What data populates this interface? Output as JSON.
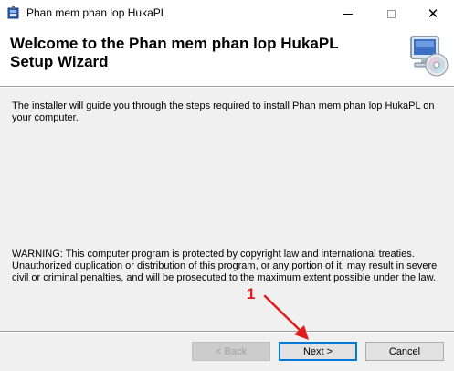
{
  "window": {
    "title": "Phan mem phan lop HukaPL"
  },
  "header": {
    "title": "Welcome to the Phan mem phan lop HukaPL Setup Wizard"
  },
  "body": {
    "intro": "The installer will guide you through the steps required to install Phan mem phan lop HukaPL on your computer.",
    "warning": "WARNING: This computer program is protected by copyright law and international treaties. Unauthorized duplication or distribution of this program, or any portion of it, may result in severe civil or criminal penalties, and will be prosecuted to the maximum extent possible under the law."
  },
  "buttons": {
    "back": "< Back",
    "next": "Next >",
    "cancel": "Cancel"
  },
  "annotation": {
    "step_number": "1",
    "color": "#e21b1b"
  },
  "icons": {
    "app": "installer-package-icon",
    "setup": "computer-cd-icon"
  }
}
